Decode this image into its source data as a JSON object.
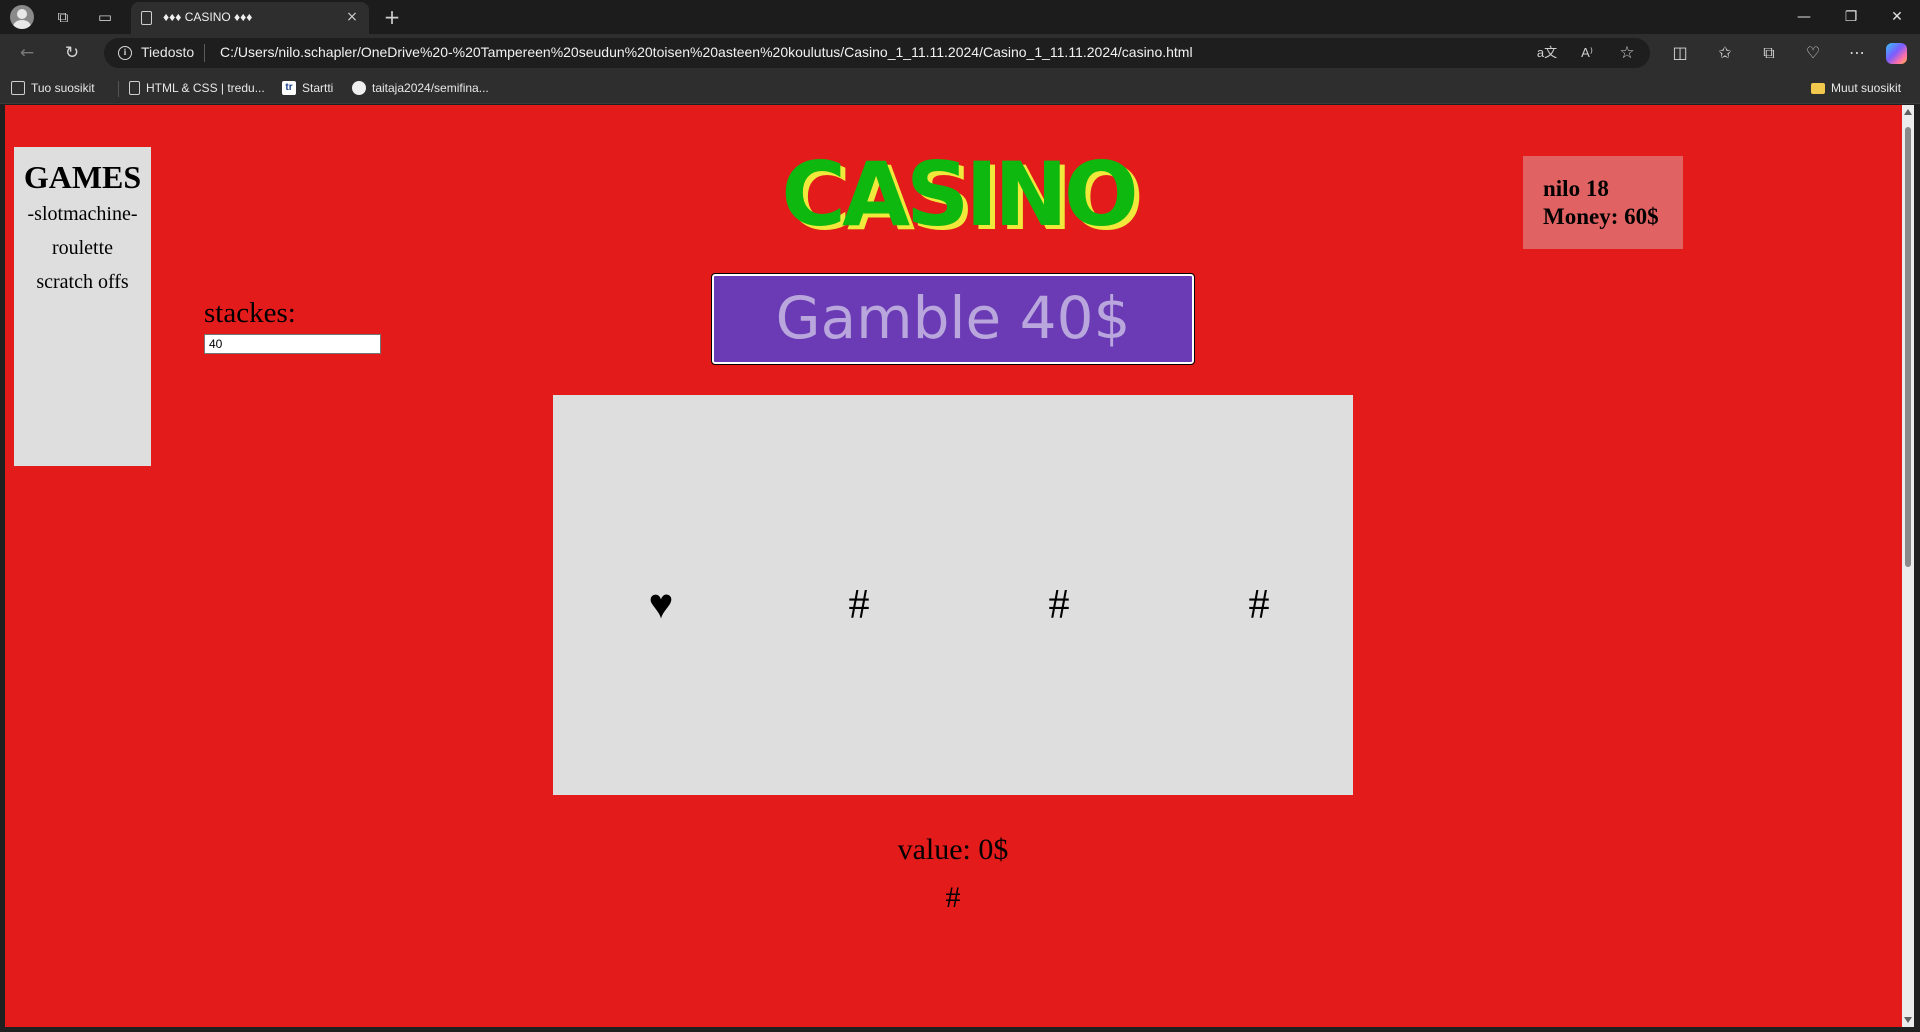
{
  "browser": {
    "tab_title": "♦♦♦ CASINO ♦♦♦",
    "tab_close_icon": "×",
    "new_tab_icon": "+",
    "site_label": "Tiedosto",
    "url": "C:/Users/nilo.schapler/OneDrive%20-%20Tampereen%20seudun%20toisen%20asteen%20koulutus/Casino_1_11.11.2024/Casino_1_11.11.2024/casino.html",
    "bookmarks": [
      {
        "label": "Tuo suosikit",
        "icon": "import-favorites-icon"
      },
      {
        "label": "HTML & CSS | tredu...",
        "icon": "page-icon"
      },
      {
        "label": "Startti",
        "icon": "tredu-icon"
      },
      {
        "label": "taitaja2024/semifina...",
        "icon": "github-icon"
      }
    ],
    "other_favorites": "Muut suosikit"
  },
  "games": {
    "title": "GAMES",
    "items": [
      "-slotmachine-",
      "roulette",
      "scratch offs"
    ]
  },
  "stakes": {
    "label": "stackes:",
    "value": "40"
  },
  "casino_title": "CASINO",
  "gamble_button": "Gamble 40$",
  "player": {
    "line1": "nilo 18",
    "line2": "Money: 60$"
  },
  "reels": [
    "♥",
    "#",
    "#",
    "#"
  ],
  "value_text": "value: 0$",
  "result_text": "#",
  "colors": {
    "page_background": "#e31b1b",
    "title_green": "#0fb80f",
    "title_shadow_yellow": "#f0e83a",
    "button_purple": "#6a3bb5",
    "panel_gray": "#dedede",
    "player_box": "#e06262"
  }
}
